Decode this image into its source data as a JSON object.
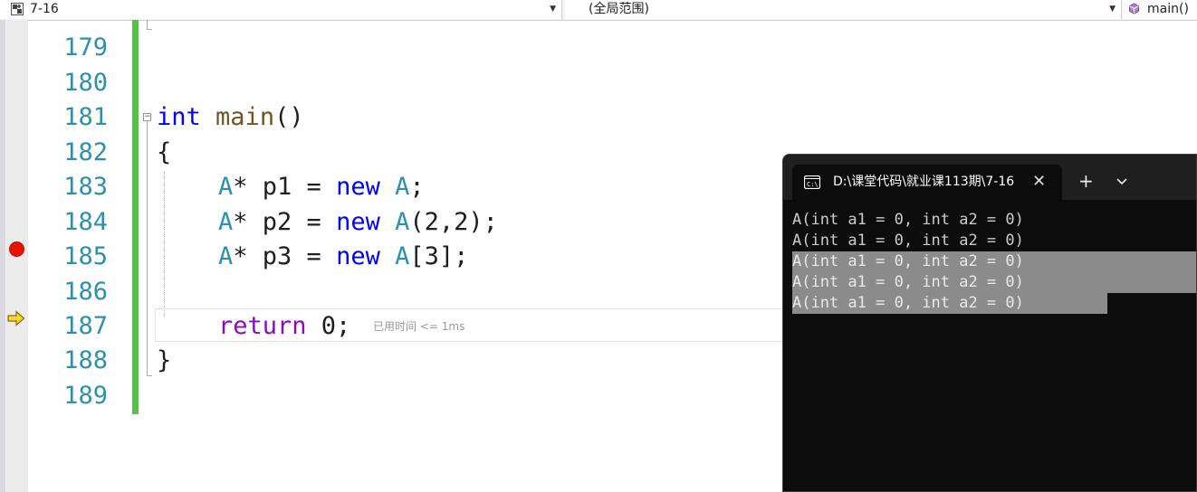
{
  "navbar": {
    "project": "7-16",
    "scope": "(全局范围)",
    "member": "main()"
  },
  "editor": {
    "lines": [
      {
        "num": "179"
      },
      {
        "num": "180"
      },
      {
        "num": "181",
        "t1": "int",
        "t2": " ",
        "t3": "main",
        "t4": "()"
      },
      {
        "num": "182",
        "t1": "{"
      },
      {
        "num": "183",
        "t1": "A",
        "t2": "* p1 = ",
        "t3": "new",
        "t4": " ",
        "t5": "A",
        "t6": ";"
      },
      {
        "num": "184",
        "t1": "A",
        "t2": "* p2 = ",
        "t3": "new",
        "t4": " ",
        "t5": "A",
        "t6": "(2,2);"
      },
      {
        "num": "185",
        "t1": "A",
        "t2": "* p3 = ",
        "t3": "new",
        "t4": " ",
        "t5": "A",
        "t6": "[3];"
      },
      {
        "num": "186"
      },
      {
        "num": "187",
        "t1": "return",
        "t2": " 0;"
      },
      {
        "num": "188",
        "t1": "}"
      },
      {
        "num": "189"
      }
    ],
    "perf_tip": "已用时间 <= 1ms",
    "breakpoint_line": "185",
    "current_line": "187"
  },
  "console": {
    "tab_title": "D:\\课堂代码\\就业课113期\\7-16",
    "new_tab_symbol": "+",
    "output": [
      "A(int a1 = 0, int a2 = 0)",
      "A(int a1 = 0, int a2 = 0)",
      "A(int a1 = 0, int a2 = 0)",
      "A(int a1 = 0, int a2 = 0)",
      "A(int a1 = 0, int a2 = 0)"
    ]
  },
  "colors": {
    "line_number": "#2b91af",
    "keyword": "#0000ff",
    "type": "#2b91af",
    "function": "#74531f",
    "control_keyword": "#8f08c4",
    "change_bar": "#57c04a",
    "breakpoint": "#e51400",
    "console_bg": "#0c0c0c",
    "console_selection": "#8b8b8b"
  },
  "icons": [
    "project-icon",
    "member-function-icon",
    "breakpoint-icon",
    "execution-arrow-icon",
    "console-icon",
    "close-icon",
    "chevron-down-icon"
  ]
}
